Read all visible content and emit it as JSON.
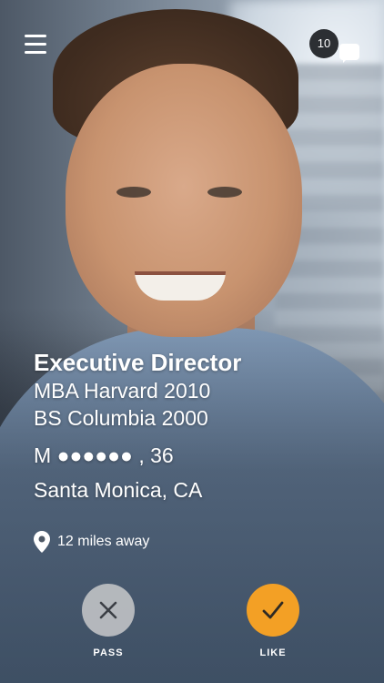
{
  "header": {
    "menu_icon": "hamburger-menu-icon",
    "message_count": "10",
    "messages_icon": "chat-bubble-icon"
  },
  "profile": {
    "title": "Executive Director",
    "education": [
      "MBA Harvard 2010",
      "BS Columbia 2000"
    ],
    "gender": "M",
    "name_mask": "●●●●●●",
    "age_suffix": ", 36",
    "location": "Santa Monica, CA",
    "distance": "12 miles away",
    "distance_icon": "location-pin-icon"
  },
  "actions": {
    "pass_label": "PASS",
    "pass_icon": "x-icon",
    "like_label": "LIKE",
    "like_icon": "checkmark-icon",
    "like_color": "#f3a025"
  }
}
